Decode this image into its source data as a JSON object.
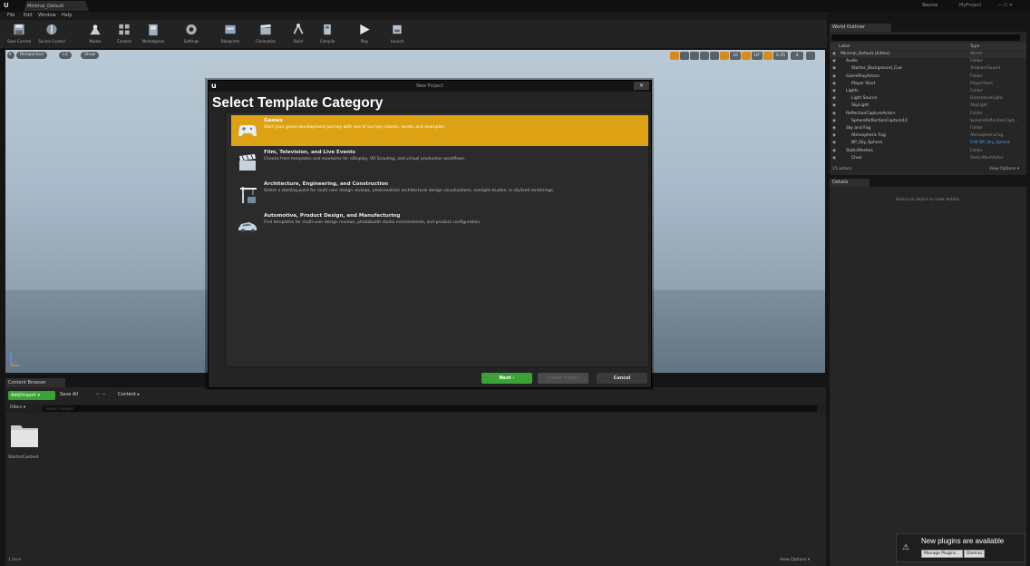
{
  "window": {
    "level_tab": "Minimal_Default",
    "source_control": "Source",
    "project_name": "MyProject",
    "controls": "—  ☐  ✕"
  },
  "menu": [
    "File",
    "Edit",
    "Window",
    "Help"
  ],
  "toolbar": [
    {
      "label": "Save Current",
      "icon": "save-icon"
    },
    {
      "label": "Source Control",
      "icon": "source-control-icon"
    },
    {
      "label": "Modes",
      "icon": "modes-icon"
    },
    {
      "label": "Content",
      "icon": "content-icon"
    },
    {
      "label": "Marketplace",
      "icon": "marketplace-icon"
    },
    {
      "label": "Settings",
      "icon": "settings-icon"
    },
    {
      "label": "Blueprints",
      "icon": "blueprints-icon"
    },
    {
      "label": "Cinematics",
      "icon": "cinematics-icon"
    },
    {
      "label": "Build",
      "icon": "build-icon"
    },
    {
      "label": "Compile",
      "icon": "compile-icon"
    },
    {
      "label": "Play",
      "icon": "play-icon"
    },
    {
      "label": "Launch",
      "icon": "launch-icon"
    }
  ],
  "viewport": {
    "perspective": "Perspective",
    "lit": "Lit",
    "show": "Show",
    "grid_snap": "10",
    "rot_snap": "10°",
    "scale_snap": "0.25",
    "camera_speed": "4"
  },
  "modal": {
    "window_title": "New Project",
    "close": "✕",
    "heading": "Select Template Category",
    "categories": [
      {
        "title": "Games",
        "desc": "Start your game development journey with one of our key classes, levels, and examples.",
        "icon": "gamepad-icon"
      },
      {
        "title": "Film, Television, and Live Events",
        "desc": "Choose from templates and examples for nDisplay, VR Scouting, and virtual production workflows.",
        "icon": "clapperboard-icon"
      },
      {
        "title": "Architecture, Engineering, and Construction",
        "desc": "Select a starting point for multi-user design reviews, photorealistic architectural design visualizations, sunlight studies, or stylized renderings.",
        "icon": "crane-icon"
      },
      {
        "title": "Automotive, Product Design, and Manufacturing",
        "desc": "Find templates for multi-user design reviews, photobooth studio environments, and product configuration.",
        "icon": "car-icon"
      }
    ],
    "buttons": {
      "next": "Next ›",
      "create": "Create Project",
      "cancel": "Cancel"
    }
  },
  "content_browser": {
    "tab": "Content Browser",
    "add_import": "Add/Import ▾",
    "save_all": "Save All",
    "nav": "← →",
    "path": "Content ▸",
    "filters": "Filters ▾",
    "search_placeholder": "Search Content",
    "folder": "StarterContent",
    "status": "1 item",
    "view_options": "View Options ▾"
  },
  "outliner": {
    "tab": "World Outliner",
    "col_label": "Label",
    "col_type": "Type",
    "rows": [
      {
        "label": "Minimal_Default (Editor)",
        "type": "World",
        "indent": 0
      },
      {
        "label": "Audio",
        "type": "Folder",
        "indent": 1
      },
      {
        "label": "Starter_Background_Cue",
        "type": "AmbientSound",
        "indent": 2
      },
      {
        "label": "GamePlayActors",
        "type": "Folder",
        "indent": 1
      },
      {
        "label": "Player Start",
        "type": "PlayerStart",
        "indent": 2
      },
      {
        "label": "Lights",
        "type": "Folder",
        "indent": 1
      },
      {
        "label": "Light Source",
        "type": "DirectionalLight",
        "indent": 2
      },
      {
        "label": "SkyLight",
        "type": "SkyLight",
        "indent": 2
      },
      {
        "label": "ReflectionCaptureActors",
        "type": "Folder",
        "indent": 1
      },
      {
        "label": "SphereReflectionCapture10",
        "type": "SphereReflectionCapt...",
        "indent": 2
      },
      {
        "label": "Sky and Fog",
        "type": "Folder",
        "indent": 1
      },
      {
        "label": "Atmospheric Fog",
        "type": "AtmosphericFog",
        "indent": 2
      },
      {
        "label": "BP_Sky_Sphere",
        "type": "Edit BP_Sky_Sphere",
        "indent": 2
      },
      {
        "label": "StaticMeshes",
        "type": "Folder",
        "indent": 1
      },
      {
        "label": "Chair",
        "type": "StaticMeshActor",
        "indent": 2
      }
    ],
    "count": "15 actors",
    "view_options": "View Options ▾"
  },
  "details": {
    "tab": "Details",
    "message": "Select an object to view details."
  },
  "notification": {
    "title": "New plugins are available",
    "manage": "Manage Plugins...",
    "dismiss": "Dismiss"
  }
}
